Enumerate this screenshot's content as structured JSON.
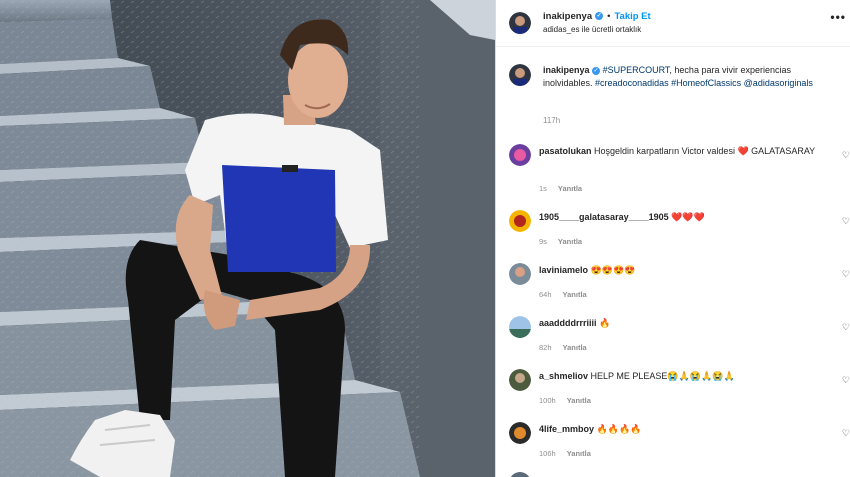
{
  "header": {
    "username": "inakipenya",
    "verified": "✓",
    "dot": "•",
    "follow_label": "Takip Et",
    "subtitle": "adidas_es ile ücretli ortaklık",
    "more": "•••"
  },
  "caption": {
    "username": "inakipenya",
    "verified": "✓",
    "hashtag1": "#SUPERCOURT",
    "text1": ", hecha para vivir experiencias inolvidables.",
    "hashtag2": "#creadoconadidas",
    "hashtag3": "#HomeofClassics",
    "mention": "@adidasoriginals",
    "time": "117h"
  },
  "comments": [
    {
      "user": "pasatolukan",
      "text": "Hoşgeldin karpatların Victor valdesi ❤️ GALATASARAY",
      "time": "1s",
      "reply": "Yanıtla"
    },
    {
      "user": "1905____galatasaray____1905",
      "text": "❤️❤️❤️",
      "time": "9s",
      "reply": "Yanıtla"
    },
    {
      "user": "laviniamelo",
      "text": "😍😍😍😍",
      "time": "64h",
      "reply": "Yanıtla"
    },
    {
      "user": "aaaddddrrriiii",
      "text": "🔥",
      "time": "82h",
      "reply": "Yanıtla"
    },
    {
      "user": "a_shmeliov",
      "text": "HELP ME PLEASE😭🙏😭🙏😭🙏",
      "time": "100h",
      "reply": "Yanıtla"
    },
    {
      "user": "4life_mmboy",
      "text": "🔥🔥🔥🔥",
      "time": "106h",
      "reply": "Yanıtla"
    }
  ],
  "heart_icon": "♡",
  "colors": {
    "accent": "#0095f6",
    "verified": "#3897f0",
    "muted": "#8e8e8e"
  }
}
